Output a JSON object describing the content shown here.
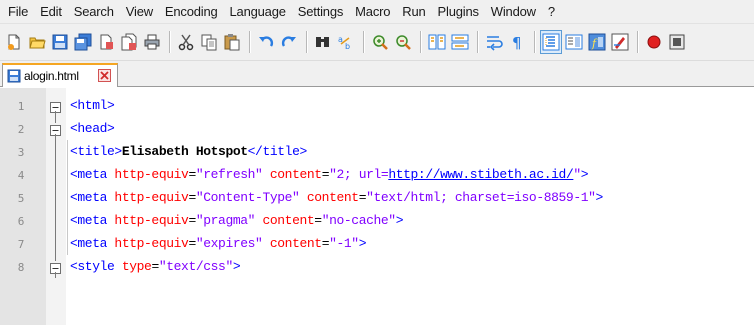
{
  "menu": {
    "items": [
      "File",
      "Edit",
      "Search",
      "View",
      "Encoding",
      "Language",
      "Settings",
      "Macro",
      "Run",
      "Plugins",
      "Window",
      "?"
    ]
  },
  "toolbar": {
    "buttons": [
      "new-file-icon",
      "open-file-icon",
      "save-icon",
      "save-all-icon",
      "close-icon",
      "close-all-icon",
      "print-icon",
      "cut-icon",
      "copy-icon",
      "paste-icon",
      "undo-icon",
      "redo-icon",
      "find-icon",
      "replace-icon",
      "zoom-in-icon",
      "zoom-out-icon",
      "sync-vertical-icon",
      "sync-horizontal-icon",
      "word-wrap-icon",
      "show-all-characters-icon",
      "indent-guide-icon",
      "document-map-icon",
      "function-list-icon",
      "folder-workspace-icon",
      "record-macro-icon",
      "stop-macro-icon"
    ],
    "active_index": 20
  },
  "tab": {
    "label": "alogin.html"
  },
  "editor": {
    "lines": [
      {
        "num": "1",
        "fold": "box",
        "text": "<html>"
      },
      {
        "num": "2",
        "fold": "box",
        "text": "<head>"
      },
      {
        "num": "3",
        "fold": "line",
        "text": "<title>Elisabeth Hotspot</title>"
      },
      {
        "num": "4",
        "fold": "line",
        "text": "<meta http-equiv=\"refresh\" content=\"2; url=http://www.stibeth.ac.id/\">"
      },
      {
        "num": "5",
        "fold": "line",
        "text": "<meta http-equiv=\"Content-Type\" content=\"text/html; charset=iso-8859-1\">"
      },
      {
        "num": "6",
        "fold": "line",
        "text": "<meta http-equiv=\"pragma\" content=\"no-cache\">"
      },
      {
        "num": "7",
        "fold": "line",
        "text": "<meta http-equiv=\"expires\" content=\"-1\">"
      },
      {
        "num": "8",
        "fold": "box",
        "text": "<style type=\"text/css\">"
      }
    ]
  },
  "colors": {
    "tag": "#0000ff",
    "attribute": "#ff0000",
    "value": "#8000ff",
    "text": "#000000",
    "tab_accent": "#f5a623",
    "gutter": "#e4e4e4"
  }
}
